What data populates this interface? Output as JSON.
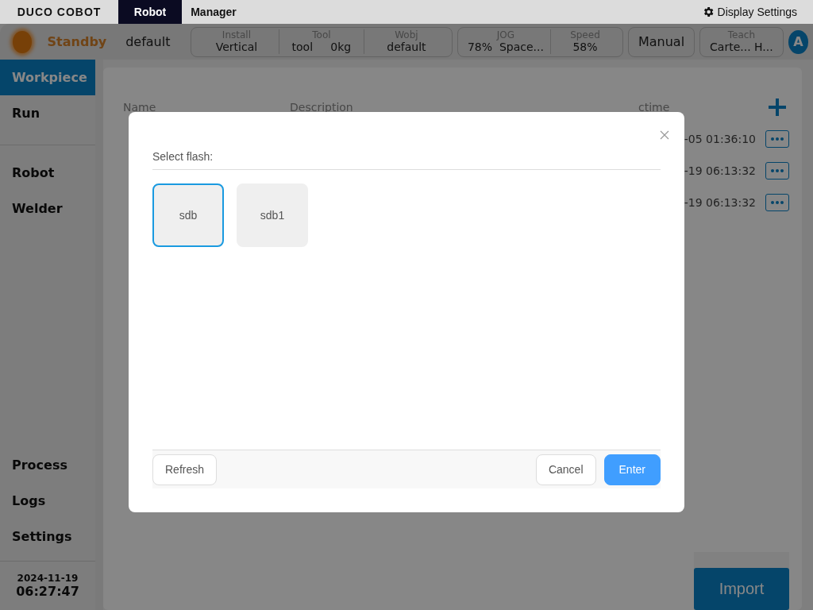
{
  "top_bar": {
    "logo": "DUCO COBOT",
    "tabs": [
      {
        "label": "Robot",
        "selected": true
      },
      {
        "label": "Manager",
        "selected": false
      }
    ],
    "display_settings": "Display Settings"
  },
  "status_bar": {
    "state": "Standby",
    "program": "default",
    "groups": [
      {
        "fields": [
          {
            "label": "Install",
            "value": "Vertical"
          },
          {
            "label": "Tool",
            "value": "tool     0kg"
          },
          {
            "label": "Wobj",
            "value": "default"
          }
        ]
      },
      {
        "fields": [
          {
            "label": "JOG",
            "value": "78%  Space..."
          },
          {
            "label": "Speed",
            "value": "58%"
          }
        ]
      },
      {
        "fields": [
          {
            "value": "Manual"
          }
        ]
      },
      {
        "fields": [
          {
            "label": "Teach",
            "value": "Carte... H..."
          }
        ]
      }
    ],
    "avatar": "A"
  },
  "sidebar": {
    "sections": [
      {
        "items": [
          {
            "label": "Workpiece",
            "selected": true
          },
          {
            "label": "Run",
            "selected": false
          }
        ]
      },
      {
        "items": [
          {
            "label": "Robot",
            "selected": false
          },
          {
            "label": "Welder",
            "selected": false
          }
        ]
      },
      {
        "items": [
          {
            "label": "Process",
            "selected": false
          },
          {
            "label": "Logs",
            "selected": false
          },
          {
            "label": "Settings",
            "selected": false
          }
        ]
      }
    ],
    "date": "2024-11-19",
    "time": "06:27:47"
  },
  "table": {
    "columns": [
      "Name",
      "Description",
      "ctime"
    ],
    "rows": [
      {
        "ctime": "-05 01:36:10"
      },
      {
        "ctime": "-19 06:13:32"
      },
      {
        "ctime": "-19 06:13:32"
      }
    ]
  },
  "import_button": "Import",
  "dialog": {
    "label": "Select flash:",
    "devices": [
      {
        "label": "sdb",
        "selected": true
      },
      {
        "label": "sdb1",
        "selected": false
      }
    ],
    "buttons": {
      "refresh": "Refresh",
      "cancel": "Cancel",
      "enter": "Enter"
    }
  }
}
